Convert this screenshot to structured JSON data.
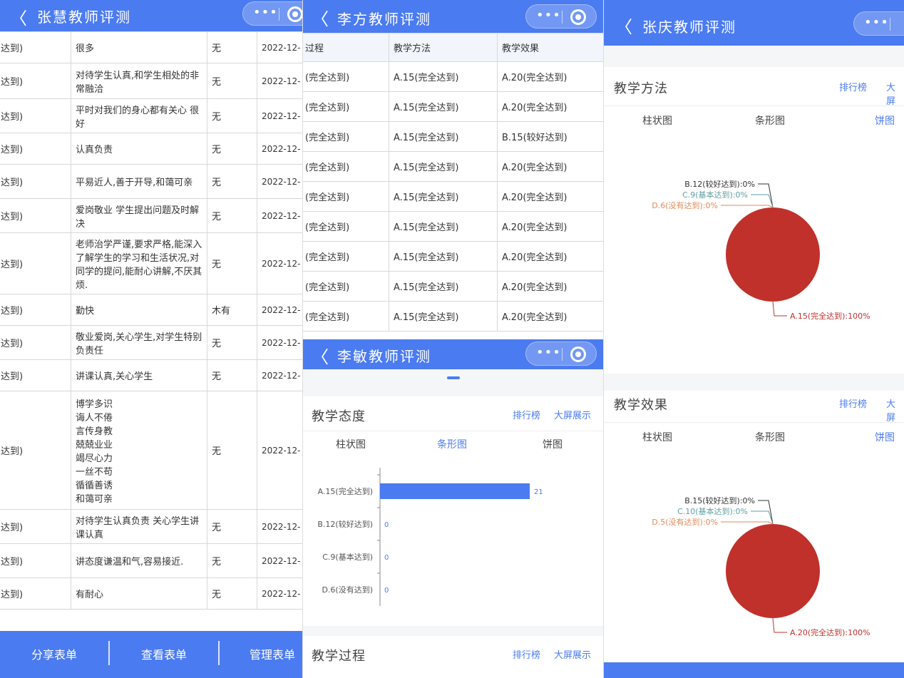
{
  "capsule": {
    "menu": "•••"
  },
  "left_panel": {
    "back": "〈",
    "title": "张慧教师评测",
    "rows": [
      {
        "c1": "达到)",
        "c2": "很多",
        "c3": "无",
        "c4": "2022-12-"
      },
      {
        "c1": "达到)",
        "c2": "对待学生认真,和学生相处的非常融洽",
        "c3": "无",
        "c4": "2022-12-"
      },
      {
        "c1": "达到)",
        "c2": "平时对我们的身心都有关心 很好",
        "c3": "无",
        "c4": "2022-12-"
      },
      {
        "c1": "达到)",
        "c2": "认真负责",
        "c3": "无",
        "c4": "2022-12-"
      },
      {
        "c1": "达到)",
        "c2": "平易近人,善于开导,和蔼可亲",
        "c3": "无",
        "c4": "2022-12-"
      },
      {
        "c1": "达到)",
        "c2": "爱岗敬业 学生提出问题及时解决",
        "c3": "无",
        "c4": "2022-12-"
      },
      {
        "c1": "达到)",
        "c2": "老师治学严谨,要求严格,能深入了解学生的学习和生活状况,对同学的提问,能耐心讲解,不厌其烦.",
        "c3": "无",
        "c4": "2022-12-"
      },
      {
        "c1": "达到)",
        "c2": "勤快",
        "c3": "木有",
        "c4": "2022-12-"
      },
      {
        "c1": "达到)",
        "c2": "敬业爱岗,关心学生,对学生特别负责任",
        "c3": "无",
        "c4": "2022-12-"
      },
      {
        "c1": "达到)",
        "c2": "讲课认真,关心学生",
        "c3": "无",
        "c4": "2022-12-"
      },
      {
        "c1": "达到)",
        "c2": "博学多识\n诲人不倦\n言传身教\n兢兢业业\n竭尽心力\n一丝不苟\n循循善诱\n和蔼可亲",
        "c3": "无",
        "c4": "2022-12-"
      },
      {
        "c1": "达到)",
        "c2": "对待学生认真负责 关心学生讲课认真",
        "c3": "无",
        "c4": "2022-12-"
      },
      {
        "c1": "达到)",
        "c2": "讲态度谦温和气,容易接近.",
        "c3": "无",
        "c4": "2022-12-"
      },
      {
        "c1": "达到)",
        "c2": "有耐心",
        "c3": "无",
        "c4": "2022-12-"
      }
    ],
    "bottom": [
      "分享表单",
      "查看表单",
      "管理表单"
    ]
  },
  "mid_top_panel": {
    "back": "〈",
    "title": "李方教师评测",
    "headers": [
      "过程",
      "教学方法",
      "教学效果"
    ],
    "rows": [
      [
        "(完全达到)",
        "A.15(完全达到)",
        "A.20(完全达到)"
      ],
      [
        "(完全达到)",
        "A.15(完全达到)",
        "A.20(完全达到)"
      ],
      [
        "(完全达到)",
        "A.15(完全达到)",
        "B.15(较好达到)"
      ],
      [
        "(完全达到)",
        "A.15(完全达到)",
        "A.20(完全达到)"
      ],
      [
        "(完全达到)",
        "A.15(完全达到)",
        "A.20(完全达到)"
      ],
      [
        "(完全达到)",
        "A.15(完全达到)",
        "A.20(完全达到)"
      ],
      [
        "(完全达到)",
        "A.15(完全达到)",
        "A.20(完全达到)"
      ],
      [
        "(完全达到)",
        "A.15(完全达到)",
        "A.20(完全达到)"
      ],
      [
        "(完全达到)",
        "A.15(完全达到)",
        "A.20(完全达到)"
      ]
    ]
  },
  "mid_bottom_panel": {
    "back": "〈",
    "title": "李敏教师评测",
    "section1": {
      "title": "教学态度",
      "rank": "排行榜",
      "bigscreen": "大屏展示"
    },
    "tabs": [
      "柱状图",
      "条形图",
      "饼图"
    ],
    "section2": {
      "title": "教学过程",
      "rank": "排行榜",
      "bigscreen": "大屏展示"
    }
  },
  "right_panel": {
    "back": "〈",
    "title": "张庆教师评测",
    "section1": {
      "title": "教学方法",
      "rank": "排行榜",
      "bigscreen": "大屏"
    },
    "section2": {
      "title": "教学效果",
      "rank": "排行榜",
      "bigscreen": "大屏"
    },
    "tabs": [
      "柱状图",
      "条形图",
      "饼图"
    ]
  },
  "colors": {
    "header_blue": "#4b7bf0",
    "pie_red": "#c0312b",
    "bar_blue": "#4b7bf0"
  },
  "chart_data": [
    {
      "type": "bar",
      "orientation": "horizontal",
      "categories": [
        "A.15(完全达到)",
        "B.12(较好达到)",
        "C.9(基本达到)",
        "D.6(没有达到)"
      ],
      "values": [
        21,
        0,
        0,
        0
      ],
      "value_labels": [
        "21",
        "0",
        "0",
        "0"
      ],
      "xlim": [
        0,
        25
      ]
    },
    {
      "type": "pie",
      "labels": [
        "B.12(较好达到):0%",
        "C.9(基本达到):0%",
        "D.6(没有达到):0%",
        "A.15(完全达到):100%"
      ],
      "values": [
        0,
        0,
        0,
        100
      ],
      "label_colors": [
        "#333333",
        "#5f9ea0",
        "#e08a5a",
        "#c0312b"
      ]
    },
    {
      "type": "pie",
      "labels": [
        "B.15(较好达到):0%",
        "C.10(基本达到):0%",
        "D.5(没有达到):0%",
        "A.20(完全达到):100%"
      ],
      "values": [
        0,
        0,
        0,
        100
      ],
      "label_colors": [
        "#333333",
        "#5f9ea0",
        "#e08a5a",
        "#c0312b"
      ]
    }
  ]
}
